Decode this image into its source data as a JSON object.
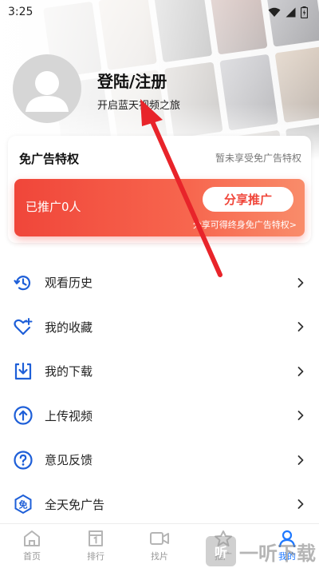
{
  "status_bar": {
    "time": "3:25"
  },
  "profile": {
    "login_title": "登陆/注册",
    "subtitle": "开启蓝天视频之旅"
  },
  "ad_free": {
    "title": "免广告特权",
    "status": "暂未享受免广告特权",
    "promoted_count": "已推广0人",
    "share_button": "分享推广",
    "hint": "分享可得终身免广告特权>"
  },
  "menu": {
    "items": [
      {
        "label": "观看历史",
        "icon": "history-icon"
      },
      {
        "label": "我的收藏",
        "icon": "favorite-icon"
      },
      {
        "label": "我的下载",
        "icon": "download-icon"
      },
      {
        "label": "上传视频",
        "icon": "upload-icon"
      },
      {
        "label": "意见反馈",
        "icon": "feedback-icon"
      },
      {
        "label": "全天免广告",
        "icon": "ad-free-icon"
      }
    ]
  },
  "bottom_nav": {
    "items": [
      {
        "label": "首页",
        "icon": "home-icon"
      },
      {
        "label": "排行",
        "icon": "ranking-icon"
      },
      {
        "label": "找片",
        "icon": "video-search-icon"
      },
      {
        "label": "推广",
        "icon": "promote-icon"
      },
      {
        "label": "我的",
        "icon": "user-icon",
        "active": true
      }
    ]
  },
  "watermark": {
    "badge": "听",
    "text": "一听下载"
  },
  "colors": {
    "accent_blue": "#1e78ff",
    "promo_red": "#f0463a",
    "annotation_red": "#e8242a"
  }
}
